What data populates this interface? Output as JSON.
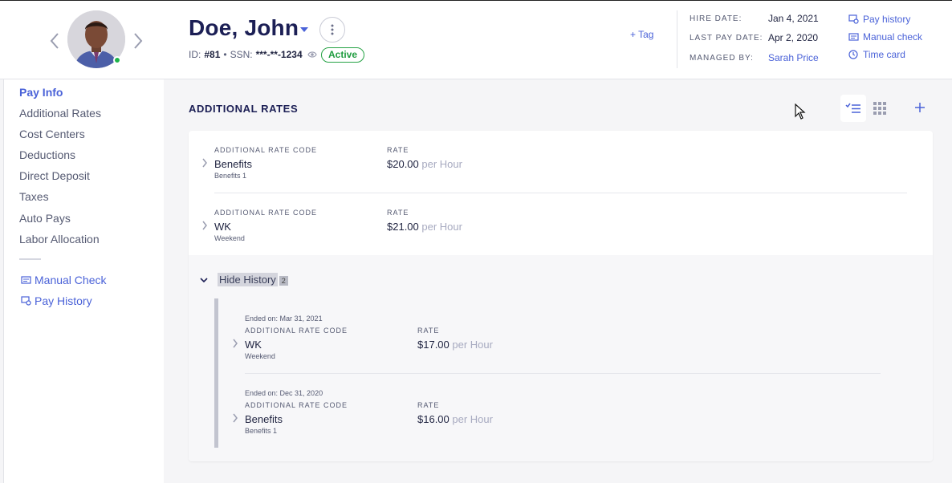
{
  "employee": {
    "name": "Doe, John",
    "id_label": "ID:",
    "id_value": "#81",
    "ssn_label": "SSN:",
    "ssn_value": "***-**-1234",
    "status": "Active",
    "tag_link": "+ Tag"
  },
  "meta": {
    "hire_date_label": "HIRE DATE:",
    "hire_date": "Jan 4, 2021",
    "last_pay_date_label": "LAST PAY DATE:",
    "last_pay_date": "Apr 2, 2020",
    "managed_by_label": "MANAGED BY:",
    "managed_by": "Sarah Price"
  },
  "quick_links": [
    "Pay history",
    "Manual check",
    "Time card"
  ],
  "sidebar": {
    "items": [
      {
        "label": "Pay Info",
        "active": true
      },
      {
        "label": "Additional Rates",
        "active": false
      },
      {
        "label": "Cost Centers",
        "active": false
      },
      {
        "label": "Deductions",
        "active": false
      },
      {
        "label": "Direct Deposit",
        "active": false
      },
      {
        "label": "Taxes",
        "active": false
      },
      {
        "label": "Auto Pays",
        "active": false
      },
      {
        "label": "Labor Allocation",
        "active": false
      }
    ],
    "links": [
      "Manual Check",
      "Pay History"
    ]
  },
  "section": {
    "title": "ADDITIONAL RATES",
    "code_header": "ADDITIONAL RATE CODE",
    "rate_header": "RATE"
  },
  "rates": [
    {
      "code": "Benefits",
      "desc": "Benefits 1",
      "rate": "$20.00",
      "unit": "per Hour"
    },
    {
      "code": "WK",
      "desc": "Weekend",
      "rate": "$21.00",
      "unit": "per Hour"
    }
  ],
  "history": {
    "label": "Hide History",
    "count": "2",
    "items": [
      {
        "ended": "Ended on: Mar 31, 2021",
        "code": "WK",
        "desc": "Weekend",
        "rate": "$17.00",
        "unit": "per Hour"
      },
      {
        "ended": "Ended on: Dec 31, 2020",
        "code": "Benefits",
        "desc": "Benefits 1",
        "rate": "$16.00",
        "unit": "per Hour"
      }
    ]
  },
  "colors": {
    "accent": "#4a62d8",
    "active_green": "#1f9c3f",
    "title_navy": "#1c1f55"
  }
}
